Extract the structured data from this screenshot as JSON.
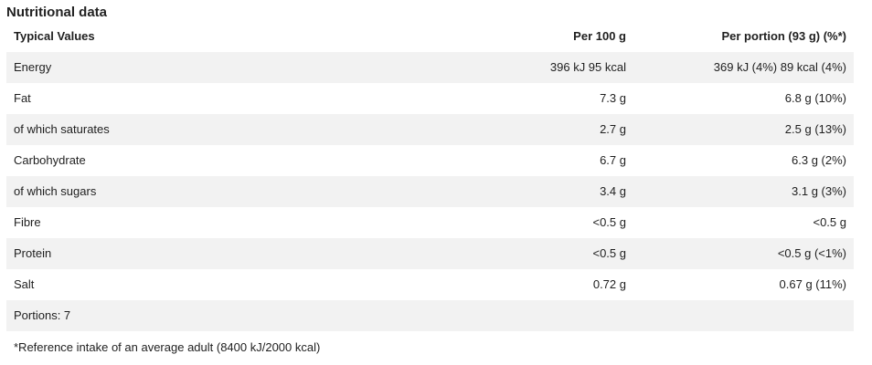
{
  "heading": "Nutritional data",
  "columns": {
    "label": "Typical Values",
    "per100": "Per 100 g",
    "portion": "Per portion (93 g) (%*)"
  },
  "rows": [
    {
      "label": "Energy",
      "per100": "396 kJ 95 kcal",
      "portion": "369 kJ (4%) 89 kcal (4%)"
    },
    {
      "label": "Fat",
      "per100": "7.3 g",
      "portion": "6.8 g (10%)"
    },
    {
      "label": "of which saturates",
      "per100": "2.7 g",
      "portion": "2.5 g (13%)"
    },
    {
      "label": "Carbohydrate",
      "per100": "6.7 g",
      "portion": "6.3 g (2%)"
    },
    {
      "label": "of which sugars",
      "per100": "3.4 g",
      "portion": "3.1 g (3%)"
    },
    {
      "label": "Fibre",
      "per100": "<0.5 g",
      "portion": "<0.5 g"
    },
    {
      "label": "Protein",
      "per100": "<0.5 g",
      "portion": "<0.5 g (<1%)"
    },
    {
      "label": "Salt",
      "per100": "0.72 g",
      "portion": "0.67 g (11%)"
    }
  ],
  "portions": "Portions: 7",
  "footnote": "*Reference intake of an average adult (8400 kJ/2000 kcal)",
  "colors": {
    "row_shade": "#f2f2f2",
    "text": "#1f1f1f"
  }
}
